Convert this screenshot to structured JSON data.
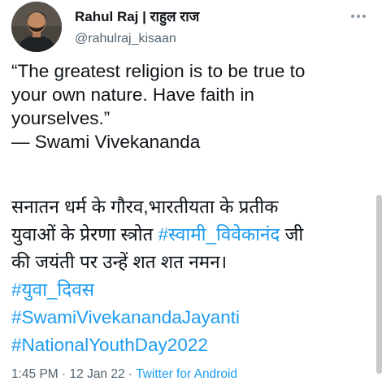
{
  "author": {
    "display_name": "Rahul Raj | राहुल राज",
    "handle": "@rahulraj_kisaan"
  },
  "tweet": {
    "quote_lines": [
      "“The greatest religion is to be true to",
      "your own nature. Have faith in",
      "yourselves.”",
      "— Swami Vivekananda"
    ],
    "hindi_line1": "सनातन धर्म के गौरव,भारतीयता के प्रतीक",
    "hindi_line2_prefix": "युवाओं के प्रेरणा स्त्रोत ",
    "hashtag_vivekanand": "#स्वामी_विवेकानंद",
    "hindi_line2_suffix": " जी",
    "hindi_line3": "की जयंती पर उन्हें शत शत नमन।",
    "hashtags": [
      "#युवा_दिवस",
      "#SwamiVivekanandaJayanti",
      "#NationalYouthDay2022"
    ]
  },
  "meta": {
    "time": "1:45 PM",
    "separator": " · ",
    "date": "12 Jan 22",
    "source": "Twitter for Android"
  },
  "icons": {
    "avatar": "profile-photo",
    "more": "more-options-icon"
  },
  "colors": {
    "link": "#1d9bf0",
    "secondary_text": "#536471",
    "primary_text": "#0f1419"
  }
}
